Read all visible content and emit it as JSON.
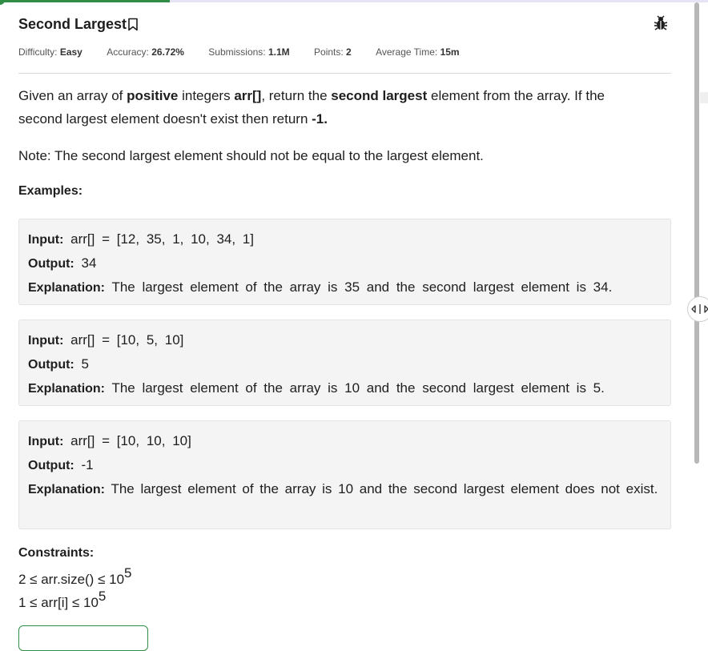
{
  "problem": {
    "title": "Second Largest",
    "bookmark_icon": "bookmark-icon",
    "report_icon": "bug-icon"
  },
  "meta": {
    "difficulty_label": "Difficulty:",
    "difficulty_value": "Easy",
    "accuracy_label": "Accuracy:",
    "accuracy_value": "26.72%",
    "submissions_label": "Submissions:",
    "submissions_value": "1.1M",
    "points_label": "Points:",
    "points_value": "2",
    "avg_time_label": "Average Time:",
    "avg_time_value": "15m"
  },
  "description": {
    "p1_a": "Given an array of ",
    "p1_b": "positive",
    "p1_c": " integers ",
    "p1_d": "arr[]",
    "p1_e": ", return the ",
    "p1_f": "second largest",
    "p1_g": " element from the array. If the second largest element doesn't exist then return ",
    "p1_h": "-1.",
    "note": "Note: The second largest element should not be equal to the largest element."
  },
  "examples_label": "Examples:",
  "examples": [
    {
      "input_label": "Input:",
      "input": "arr[] = [12, 35, 1, 10, 34, 1]",
      "output_label": "Output:",
      "output": "34",
      "explanation_label": "Explanation:",
      "explanation": "The largest element of the array is 35 and the second largest element is 34."
    },
    {
      "input_label": "Input:",
      "input": "arr[] = [10, 5, 10]",
      "output_label": "Output:",
      "output": "5",
      "explanation_label": "Explanation:",
      "explanation": "The largest element of the array is 10 and the second largest element is 5."
    },
    {
      "input_label": "Input:",
      "input": "arr[] = [10, 10, 10]",
      "output_label": "Output:",
      "output": "-1",
      "explanation_label": "Explanation:",
      "explanation": "The largest element of the array is 10 and the second largest element does not exist."
    }
  ],
  "constraints_label": "Constraints:",
  "constraints": [
    {
      "text": "2 ≤ arr.size() ≤ 10",
      "exp": "5"
    },
    {
      "text": "1 ≤ arr[i] ≤ 10",
      "exp": "5"
    }
  ],
  "colors": {
    "accent": "#2f8d46",
    "example_bg": "#f4f4f4"
  }
}
